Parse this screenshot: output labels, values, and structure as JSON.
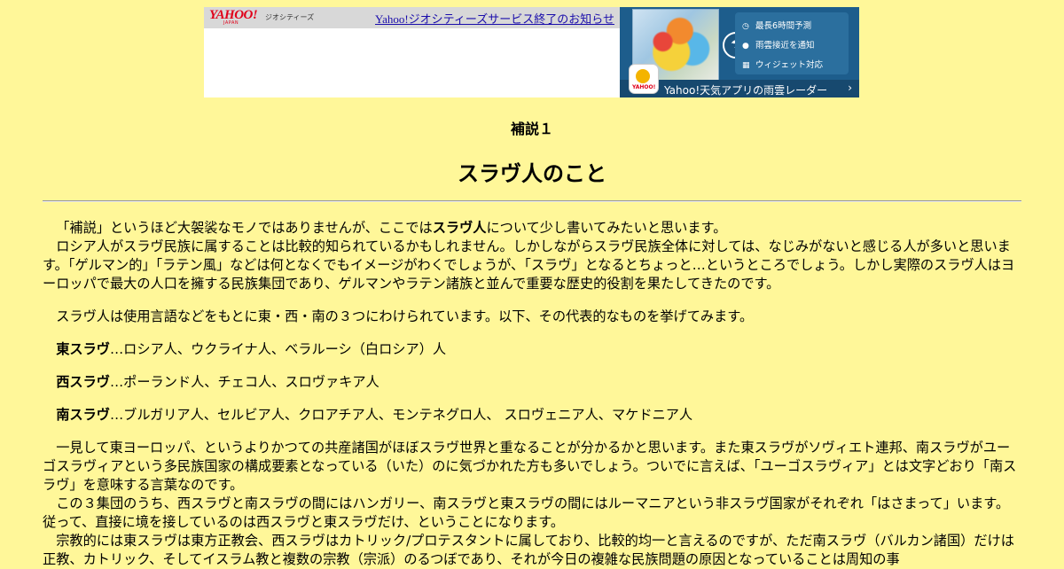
{
  "banner": {
    "logo": "YAHOO!",
    "logo_sub": "JAPAN",
    "logo_text": "ジオシティーズ",
    "notice_link": "Yahoo!ジオシティーズサービス終了のお知らせ",
    "ad": {
      "features": [
        "最長6時間予測",
        "雨雲接近を通知",
        "ウィジェット対応"
      ],
      "bar_text": "Yahoo!天気アプリの雨雲レーダー",
      "app_icon_text": "YAHOO!",
      "colors": {
        "bg": "#1d5d8c",
        "panel": "#2b6f9e",
        "bar": "#17496f"
      }
    }
  },
  "page": {
    "subtitle": "補説１",
    "title": "スラヴ人のこと",
    "background": "#fff799"
  },
  "article": {
    "intro": {
      "pre": "「補説」というほど大袈裟なモノではありませんが、ここでは",
      "bold": "スラヴ人",
      "post": "について少し書いてみたいと思います。"
    },
    "p2": "ロシア人がスラヴ民族に属することは比較的知られているかもしれません。しかしながらスラヴ民族全体に対しては、なじみがないと感じる人が多いと思います。「ゲルマン的」「ラテン風」などは何となくでもイメージがわくでしょうが、「スラヴ」となるとちょっと…というところでしょう。しかし実際のスラヴ人はヨーロッパで最大の人口を擁する民族集団であり、ゲルマンやラテン諸族と並んで重要な歴史的役割を果たしてきたのです。",
    "p3": "スラヴ人は使用言語などをもとに東・西・南の３つにわけられています。以下、その代表的なものを挙げてみます。",
    "groups": [
      {
        "name": "東スラヴ",
        "members": "…ロシア人、ウクライナ人、ベラルーシ（白ロシア）人"
      },
      {
        "name": "西スラヴ",
        "members": "…ポーランド人、チェコ人、スロヴァキア人"
      },
      {
        "name": "南スラヴ",
        "members": "…ブルガリア人、セルビア人、クロアチア人、モンテネグロ人、 スロヴェニア人、マケドニア人"
      }
    ],
    "p4": "一見して東ヨーロッパ、というよりかつての共産諸国がほぼスラヴ世界と重なることが分かるかと思います。また東スラヴがソヴィエト連邦、南スラヴがユーゴスラヴィアという多民族国家の構成要素となっている（いた）のに気づかれた方も多いでしょう。ついでに言えば、「ユーゴスラヴィア」とは文字どおり「南スラヴ」を意味する言葉なのです。",
    "p5": "この３集団のうち、西スラヴと南スラヴの間にはハンガリー、南スラヴと東スラヴの間にはルーマニアという非スラヴ国家がそれぞれ「はさまって」います。従って、直接に境を接しているのは西スラヴと東スラヴだけ、ということになります。",
    "p6": "宗教的には東スラヴは東方正教会、西スラヴはカトリック/プロテスタントに属しており、比較的均一と言えるのですが、ただ南スラヴ（バルカン諸国）だけは正教、カトリック、そしてイスラム教と複数の宗教（宗派）のるつぼであり、それが今日の複雑な民族問題の原因となっていることは周知の事"
  }
}
